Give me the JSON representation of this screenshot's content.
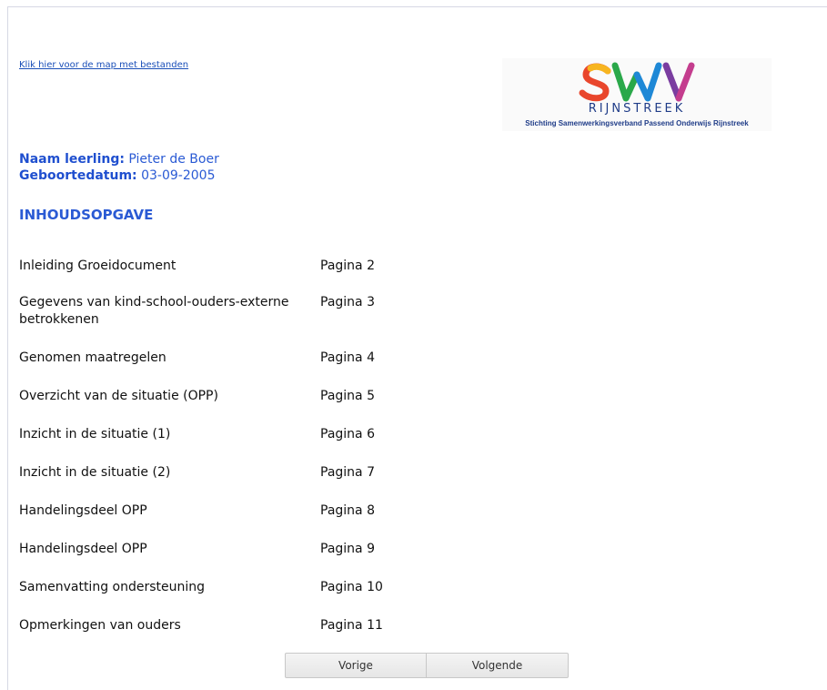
{
  "files_link": "Klik hier voor de map met bestanden",
  "logo": {
    "letters": [
      "S",
      "W",
      "V"
    ],
    "name": "RIJNSTREEK",
    "subtitle": "Stichting Samenwerkingsverband Passend Onderwijs Rijnstreek"
  },
  "student": {
    "name_label": "Naam leerling:",
    "name_value": "Pieter de Boer",
    "dob_label": "Geboortedatum:",
    "dob_value": "03-09-2005"
  },
  "toc": {
    "title": "INHOUDSOPGAVE",
    "items": [
      {
        "title": "Inleiding Groeidocument",
        "page": "Pagina 2"
      },
      {
        "title": "Gegevens van kind-school-ouders-externe betrokkenen",
        "page": "Pagina 3"
      },
      {
        "title": "Genomen maatregelen",
        "page": "Pagina 4"
      },
      {
        "title": "Overzicht van de situatie (OPP)",
        "page": "Pagina 5"
      },
      {
        "title": "Inzicht in de situatie (1)",
        "page": "Pagina 6"
      },
      {
        "title": "Inzicht in de situatie (2)",
        "page": "Pagina 7"
      },
      {
        "title": "Handelingsdeel OPP",
        "page": "Pagina 8"
      },
      {
        "title": "Handelingsdeel OPP",
        "page": "Pagina 9"
      },
      {
        "title": "Samenvatting ondersteuning",
        "page": "Pagina 10"
      },
      {
        "title": "Opmerkingen van ouders",
        "page": "Pagina 11"
      }
    ]
  },
  "nav": {
    "prev": "Vorige",
    "next": "Volgende"
  }
}
